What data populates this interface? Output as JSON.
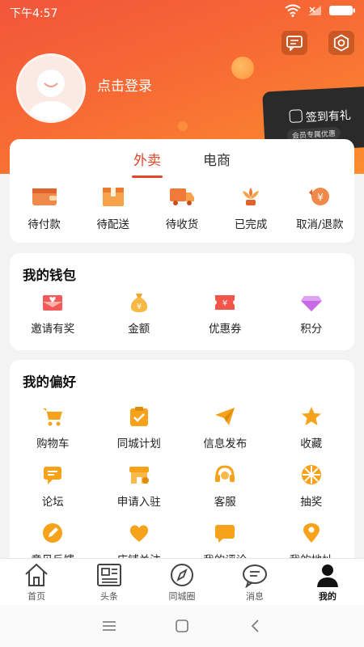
{
  "status_bar": {
    "time": "下午4:57"
  },
  "profile": {
    "login_text": "点击登录"
  },
  "signin_badge": {
    "title": "签到有礼",
    "subtitle": "会员专属优惠"
  },
  "orders": {
    "tabs": [
      "外卖",
      "电商"
    ],
    "items": [
      {
        "label": "待付款",
        "icon": "wallet-icon"
      },
      {
        "label": "待配送",
        "icon": "package-icon"
      },
      {
        "label": "待收货",
        "icon": "truck-icon"
      },
      {
        "label": "已完成",
        "icon": "flower-icon"
      },
      {
        "label": "取消/退款",
        "icon": "refund-icon"
      }
    ]
  },
  "wallet": {
    "title": "我的钱包",
    "items": [
      {
        "label": "邀请有奖",
        "icon": "envelope-heart-icon"
      },
      {
        "label": "金额",
        "icon": "money-bag-icon"
      },
      {
        "label": "优惠券",
        "icon": "coupon-icon"
      },
      {
        "label": "积分",
        "icon": "diamond-icon"
      }
    ]
  },
  "preferences": {
    "title": "我的偏好",
    "items": [
      {
        "label": "购物车",
        "icon": "cart-icon"
      },
      {
        "label": "同城计划",
        "icon": "checklist-icon"
      },
      {
        "label": "信息发布",
        "icon": "paper-plane-icon"
      },
      {
        "label": "收藏",
        "icon": "star-icon"
      },
      {
        "label": "论坛",
        "icon": "chat-icon"
      },
      {
        "label": "申请入驻",
        "icon": "shop-icon"
      },
      {
        "label": "客服",
        "icon": "headset-icon"
      },
      {
        "label": "抽奖",
        "icon": "wheel-icon"
      },
      {
        "label": "意见反馈",
        "icon": "pencil-icon"
      },
      {
        "label": "店铺关注",
        "icon": "heart-icon"
      },
      {
        "label": "我的评论",
        "icon": "comment-icon"
      },
      {
        "label": "我的地址",
        "icon": "location-icon"
      }
    ]
  },
  "tabbar": {
    "items": [
      {
        "label": "首页",
        "icon": "home-icon"
      },
      {
        "label": "头条",
        "icon": "news-icon"
      },
      {
        "label": "同城圈",
        "icon": "compass-icon"
      },
      {
        "label": "消息",
        "icon": "message-icon"
      },
      {
        "label": "我的",
        "icon": "person-icon"
      }
    ],
    "active_index": 4
  },
  "colors": {
    "accent": "#e8442a",
    "header_start": "#f1553a",
    "header_end": "#fb8e2e",
    "icon_orange": "#f7a21b"
  }
}
